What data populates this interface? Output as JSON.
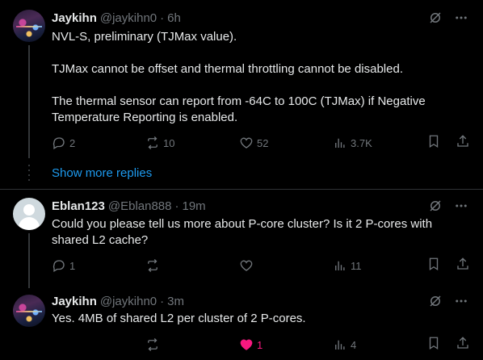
{
  "tweets": [
    {
      "name": "Jaykihn",
      "handle": "@jaykihn0",
      "sep": "·",
      "time": "6h",
      "paragraphs": [
        "NVL-S, preliminary (TJMax value).",
        "TJMax cannot be offset and thermal throttling cannot be disabled.",
        "The thermal sensor can report from -64C to 100C (TJMax) if Negative Temperature Reporting is enabled."
      ],
      "replies": "2",
      "reposts": "10",
      "likes": "52",
      "views": "3.7K"
    },
    {
      "name": "Eblan123",
      "handle": "@Eblan888",
      "sep": "·",
      "time": "19m",
      "text": "Could you please tell us more about P-core cluster? Is it 2 P-cores with shared L2 cache?",
      "replies": "1",
      "reposts": "",
      "likes": "",
      "views": "11"
    },
    {
      "name": "Jaykihn",
      "handle": "@jaykihn0",
      "sep": "·",
      "time": "3m",
      "text": "Yes. 4MB of shared L2 per cluster of 2 P-cores.",
      "replies": "",
      "reposts": "",
      "likes": "1",
      "views": "4"
    }
  ],
  "show_more": "Show more replies",
  "colors": {
    "background": "#000000",
    "text": "#e7e9ea",
    "muted": "#71767b",
    "link": "#1d9bf0",
    "like_active": "#f91880"
  }
}
